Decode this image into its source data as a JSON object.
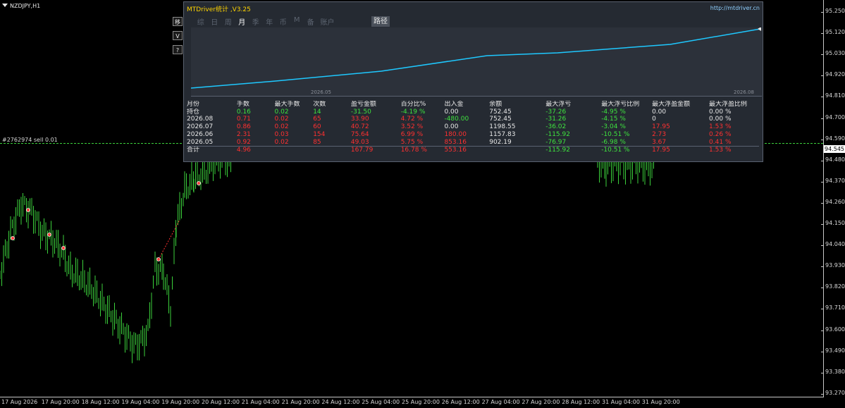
{
  "chart": {
    "symbol": "NZDJPY,H1",
    "order_label": "#2762974 sell 0.01",
    "current_price": "94.545",
    "price_labels": [
      "95.250",
      "95.120",
      "95.030",
      "94.920",
      "94.810",
      "94.700",
      "94.590",
      "94.480",
      "94.370",
      "94.260",
      "94.150",
      "94.040",
      "93.930",
      "93.820",
      "93.710",
      "93.600",
      "93.490",
      "93.380",
      "93.270"
    ],
    "time_labels": [
      "17 Aug 2026",
      "17 Aug 20:00",
      "18 Aug 12:00",
      "19 Aug 04:00",
      "19 Aug 20:00",
      "20 Aug 12:00",
      "21 Aug 04:00",
      "21 Aug 20:00",
      "24 Aug 12:00",
      "25 Aug 04:00",
      "25 Aug 20:00",
      "26 Aug 12:00",
      "27 Aug 04:00",
      "27 Aug 20:00",
      "28 Aug 12:00",
      "31 Aug 04:00",
      "31 Aug 20:00"
    ],
    "colors": {
      "bull": "#3bd13b",
      "bear": "#3bd13b",
      "background": "#000000",
      "order_line": "#3bd13b"
    }
  },
  "side_buttons": [
    "移",
    "V",
    "?"
  ],
  "panel": {
    "title": "MTDriver统计 ,V3.25",
    "link": "http://mtdriver.cn",
    "tabs": [
      "综",
      "日",
      "周",
      "月",
      "季",
      "年",
      "币",
      "M",
      "备",
      "账户"
    ],
    "active_tab": "月",
    "route_button": "路径",
    "equity": {
      "start_label": "2026.05",
      "end_label": "2026.08",
      "line_color": "#1ec8ff"
    },
    "headers": [
      "月份",
      "手数",
      "最大手数",
      "次数",
      "盈亏金额",
      "百分比%",
      "出入金",
      "余额",
      "最大浮亏",
      "最大浮亏比例",
      "最大浮盈金额",
      "最大浮盈比例"
    ],
    "rows": [
      {
        "cells": [
          "持仓",
          "0.16",
          "0.02",
          "14",
          "-31.50",
          "-4.19 %",
          "0.00",
          "752.45",
          "-37.26",
          "-4.95 %",
          "0.00",
          "0.00 %"
        ],
        "colors": [
          "w",
          "g",
          "g",
          "g",
          "g",
          "g",
          "w",
          "w",
          "g",
          "g",
          "w",
          "w"
        ]
      },
      {
        "cells": [
          "2026.08",
          "0.71",
          "0.02",
          "65",
          "33.90",
          "4.72 %",
          "-480.00",
          "752.45",
          "-31.26",
          "-4.15 %",
          "0",
          "0.00 %"
        ],
        "colors": [
          "w",
          "r",
          "r",
          "r",
          "r",
          "r",
          "g",
          "w",
          "g",
          "g",
          "w",
          "w"
        ]
      },
      {
        "cells": [
          "2026.07",
          "0.86",
          "0.02",
          "60",
          "40.72",
          "3.52 %",
          "0.00",
          "1198.55",
          "-36.02",
          "-3.04 %",
          "17.95",
          "1.53 %"
        ],
        "colors": [
          "w",
          "r",
          "r",
          "r",
          "r",
          "r",
          "w",
          "w",
          "g",
          "g",
          "r",
          "r"
        ]
      },
      {
        "cells": [
          "2026.06",
          "2.31",
          "0.03",
          "154",
          "75.64",
          "6.99 %",
          "180.00",
          "1157.83",
          "-115.92",
          "-10.51 %",
          "2.73",
          "0.26 %"
        ],
        "colors": [
          "w",
          "r",
          "r",
          "r",
          "r",
          "r",
          "r",
          "w",
          "g",
          "g",
          "r",
          "r"
        ]
      },
      {
        "cells": [
          "2026.05",
          "0.92",
          "0.02",
          "85",
          "49.03",
          "5.75 %",
          "853.16",
          "902.19",
          "-76.97",
          "-6.98 %",
          "3.67",
          "0.41 %"
        ],
        "colors": [
          "w",
          "r",
          "r",
          "r",
          "r",
          "r",
          "r",
          "w",
          "g",
          "g",
          "r",
          "r"
        ]
      },
      {
        "cells": [
          "合计",
          "4.96",
          "",
          "",
          "167.79",
          "16.78 %",
          "553.16",
          "",
          "-115.92",
          "-10.51 %",
          "17.95",
          "1.53 %"
        ],
        "colors": [
          "w",
          "r",
          "r",
          "r",
          "r",
          "r",
          "r",
          "w",
          "g",
          "g",
          "r",
          "r"
        ]
      }
    ]
  }
}
